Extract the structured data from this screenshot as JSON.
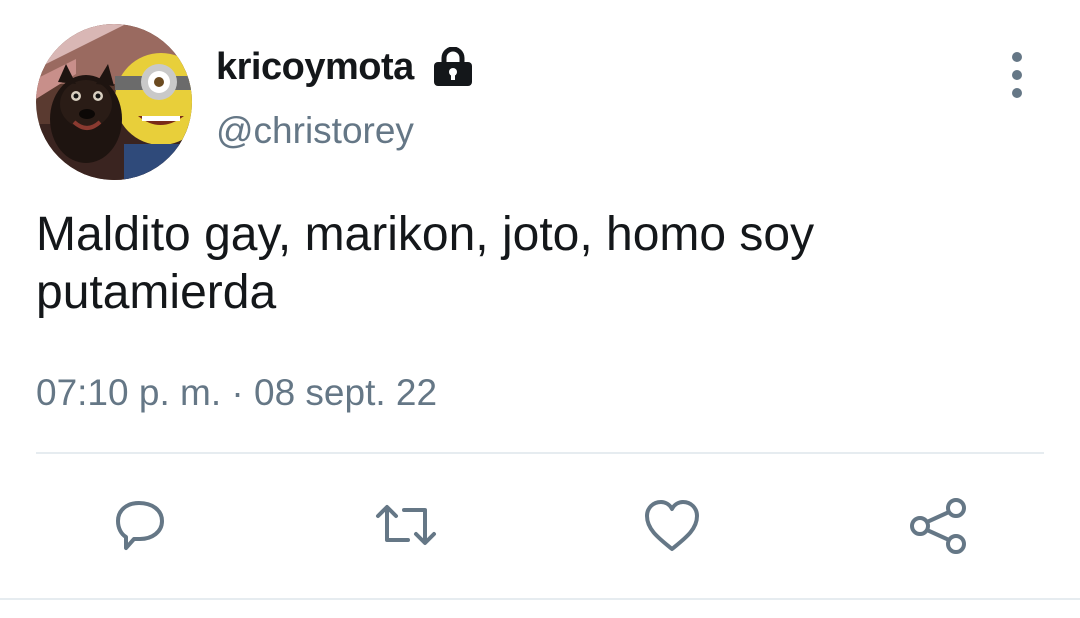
{
  "user": {
    "display_name": "kricoymota",
    "handle": "@christorey",
    "protected_icon": "lock-icon",
    "avatar": "avatar-icon"
  },
  "tweet": {
    "text": "Maldito gay, marikon, joto, homo soy putamierda",
    "timestamp": "07:10 p. m. · 08 sept. 22"
  },
  "header": {
    "more_icon": "more-vertical-icon"
  },
  "actions": {
    "reply_icon": "reply-icon",
    "retweet_icon": "retweet-icon",
    "like_icon": "heart-icon",
    "share_icon": "share-icon"
  },
  "colors": {
    "text_primary": "#14171a",
    "text_secondary": "#657786",
    "divider": "#e6ecf0"
  }
}
